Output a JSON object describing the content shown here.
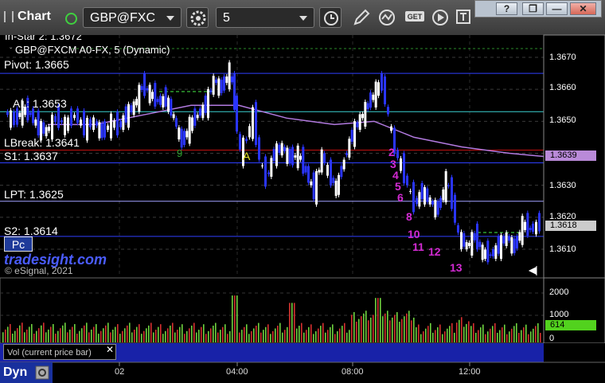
{
  "toolbar": {
    "title": "Chart",
    "symbol": "GBP@FXC",
    "interval": "5",
    "get_label": "GET"
  },
  "window_controls": {
    "help": "?",
    "restore": "❐",
    "minimize": "—",
    "close": "✕"
  },
  "chart": {
    "instrument_line": "GBP@FXCM A0-FX, 5 (Dynamic)",
    "top_clipped_label": "In-Star 2: 1.3672",
    "levels": [
      {
        "label": "Pivot: 1.3665",
        "value": 1.3665,
        "color": "#2f3fff"
      },
      {
        "label": "AL: 1.3653",
        "value": 1.3653,
        "color": "#3ad0d0"
      },
      {
        "label": "LBreak: 1.3641",
        "value": 1.3641,
        "color": "#c01010"
      },
      {
        "label": "S1: 1.3637",
        "value": 1.3637,
        "color": "#2f3fff"
      },
      {
        "label": "LPT: 1.3625",
        "value": 1.3625,
        "color": "#a0a0ff"
      },
      {
        "label": "S2: 1.3614",
        "value": 1.3614,
        "color": "#2f3fff"
      }
    ],
    "price_axis": [
      "1.3670",
      "1.3660",
      "1.3650",
      "1.3640",
      "1.3630",
      "1.3620",
      "1.3610"
    ],
    "price_tags": [
      {
        "text": "1.3639",
        "bg": "#b98ad8",
        "fg": "#000"
      },
      {
        "text": "1.3618",
        "bg": "#cccccc",
        "fg": "#000"
      }
    ],
    "annotations": {
      "a_label": "A",
      "sequence_green": [
        "9"
      ],
      "sequence_magenta": [
        "2",
        "3",
        "4",
        "5",
        "6",
        "8",
        "10",
        "11",
        "12",
        "13"
      ]
    },
    "pc_button": "Pc",
    "watermark": "tradesight.com",
    "copyright": "© eSignal, 2021"
  },
  "volume": {
    "label": "Vol (current price bar)",
    "axis": [
      "2000",
      "1000",
      "0"
    ],
    "current_tag": "614",
    "close_icon": "✕"
  },
  "time_axis": [
    "02",
    "04:00",
    "08:00",
    "12:00"
  ],
  "footer": {
    "dyn": "Dyn"
  },
  "colors": {
    "up_candle": "#ffffff",
    "down_candle": "#2a35ff",
    "vol_up": "#6fd23f",
    "vol_down": "#d63030",
    "ma_line": "#b27ae0",
    "green_dash": "#2fa02f"
  }
}
